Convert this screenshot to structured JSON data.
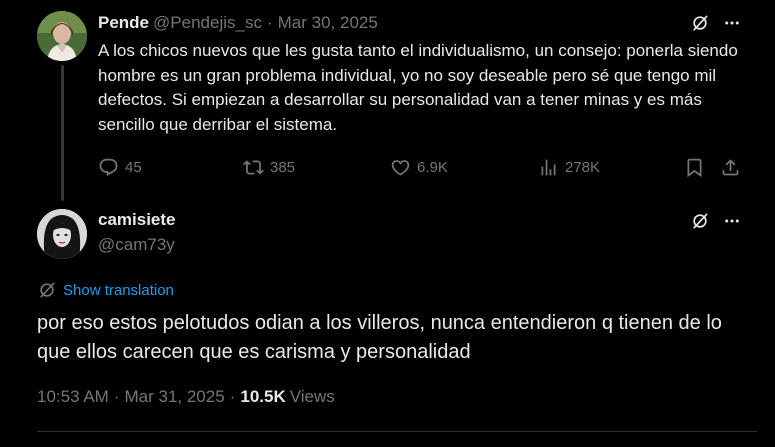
{
  "parent_tweet": {
    "author_name": "Pende",
    "author_handle": "@Pendejis_sc",
    "separator": "·",
    "date": "Mar 30, 2025",
    "text": "A los chicos nuevos que les gusta tanto el individualismo, un consejo: ponerla siendo hombre es un gran problema individual, yo no soy deseable pero sé que tengo mil defectos. Si empiezan a desarrollar su personalidad van a tener minas y es más sencillo que derribar el sistema.",
    "replies": "45",
    "reposts": "385",
    "likes": "6.9K",
    "views": "278K"
  },
  "reply_tweet": {
    "author_name": "camisiete",
    "author_handle": "@cam73y",
    "translate_label": "Show translation",
    "text": "por eso estos pelotudos odian a los villeros, nunca entendieron q tienen de lo que ellos carecen que es carisma y personalidad",
    "time": "10:53 AM",
    "separator": "·",
    "date": "Mar 31, 2025",
    "separator2": "·",
    "views_count": "10.5K",
    "views_label": "Views"
  },
  "icons": {
    "reply": "reply-icon",
    "repost": "repost-icon",
    "like": "heart-icon",
    "views": "analytics-icon",
    "bookmark": "bookmark-icon",
    "share": "share-icon",
    "grok": "grok-icon",
    "more": "more-icon",
    "translate": "globe-icon"
  },
  "colors": {
    "background": "#000000",
    "text": "#e7e9ea",
    "muted": "#71767b",
    "link": "#1d9bf0",
    "divider": "#2f3336"
  }
}
